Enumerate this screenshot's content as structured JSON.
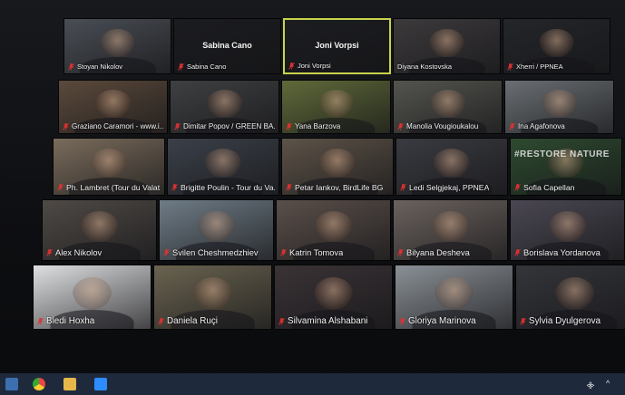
{
  "meeting": {
    "mic_icon": "mic-muted-icon",
    "accent_color": "#c7d34a",
    "muted_color": "#e03131"
  },
  "tiles": [
    {
      "name": "Stoyan Nikolov",
      "center_name": "",
      "banner": "",
      "muted": true,
      "color": "#4a4e55"
    },
    {
      "name": "Sabina Cano",
      "center_name": "Sabina Cano",
      "banner": "",
      "muted": true,
      "color": "#1b1c20"
    },
    {
      "name": "Joni Vorpsi",
      "center_name": "Joni Vorpsi",
      "banner": "",
      "muted": true,
      "color": "#1c1d21",
      "active": true
    },
    {
      "name": "Diyana Kostovska",
      "center_name": "",
      "banner": "",
      "muted": false,
      "color": "#3d3a3c"
    },
    {
      "name": "Xherri / PPNEA",
      "center_name": "",
      "banner": "",
      "muted": true,
      "color": "#24262a"
    },
    {
      "name": "Graziano Caramori - www.i...",
      "center_name": "",
      "banner": "",
      "muted": true,
      "color": "#5b4a3c"
    },
    {
      "name": "Dimitar Popov / GREEN BA...",
      "center_name": "",
      "banner": "",
      "muted": true,
      "color": "#3f4042"
    },
    {
      "name": "Yana Barzova",
      "center_name": "",
      "banner": "",
      "muted": true,
      "color": "#5f6a3a"
    },
    {
      "name": "Manolia Vougioukalou",
      "center_name": "",
      "banner": "",
      "muted": true,
      "color": "#54544f"
    },
    {
      "name": "Ina Agafonova",
      "center_name": "",
      "banner": "",
      "muted": true,
      "color": "#6a6f73"
    },
    {
      "name": "Ph. Lambret (Tour du Valat...",
      "center_name": "",
      "banner": "",
      "muted": true,
      "color": "#7a6c5c"
    },
    {
      "name": "Brigitte Poulin - Tour du Va...",
      "center_name": "",
      "banner": "",
      "muted": true,
      "color": "#3b4049"
    },
    {
      "name": "Petar Iankov, BirdLife BG",
      "center_name": "",
      "banner": "",
      "muted": true,
      "color": "#5d5348"
    },
    {
      "name": "Ledi Selgjekaj, PPNEA",
      "center_name": "",
      "banner": "",
      "muted": true,
      "color": "#3a3b41"
    },
    {
      "name": "Sofia Capellan",
      "center_name": "",
      "banner": "#RESTORE NATURE",
      "muted": true,
      "color": "#2e4a30"
    },
    {
      "name": "Alex Nikolov",
      "center_name": "",
      "banner": "",
      "muted": true,
      "color": "#4f4a46"
    },
    {
      "name": "Svilen Cheshmedzhiev",
      "center_name": "",
      "banner": "",
      "muted": true,
      "color": "#6f7c86"
    },
    {
      "name": "Katrin Tomova",
      "center_name": "",
      "banner": "",
      "muted": true,
      "color": "#5a4f4a"
    },
    {
      "name": "Bilyana Desheva",
      "center_name": "",
      "banner": "",
      "muted": true,
      "color": "#6b625e"
    },
    {
      "name": "Borislava Yordanova",
      "center_name": "",
      "banner": "",
      "muted": true,
      "color": "#4a4752"
    },
    {
      "name": "Bledi Hoxha",
      "center_name": "",
      "banner": "",
      "muted": true,
      "color": "#dfe0e2"
    },
    {
      "name": "Daniela Ruçi",
      "center_name": "",
      "banner": "",
      "muted": true,
      "color": "#6a6350"
    },
    {
      "name": "Silvamina Alshabani",
      "center_name": "",
      "banner": "",
      "muted": true,
      "color": "#3a3336"
    },
    {
      "name": "Gloriya Marinova",
      "center_name": "",
      "banner": "",
      "muted": true,
      "color": "#8a9096"
    },
    {
      "name": "Sylvia Dyulgerova",
      "center_name": "",
      "banner": "",
      "muted": true,
      "color": "#34353a"
    }
  ],
  "taskbar": {
    "icons": [
      "start-icon",
      "browser-icon",
      "folder-icon",
      "zoom-app-icon"
    ],
    "tray": [
      "network-icon",
      "chevron-up-icon"
    ]
  }
}
